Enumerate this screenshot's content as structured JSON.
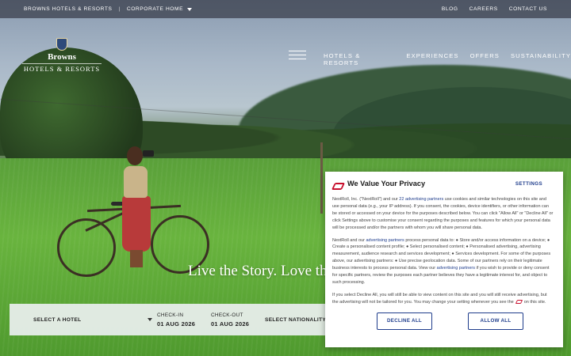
{
  "topbar": {
    "brand": "BROWNS HOTELS & RESORTS",
    "separator": "|",
    "corporate_home": "CORPORATE HOME",
    "links": [
      "BLOG",
      "CAREERS",
      "CONTACT US"
    ]
  },
  "logo": {
    "name": "Browns",
    "subtitle": "HOTELS & RESORTS"
  },
  "nav": {
    "items": [
      "HOTELS & RESORTS",
      "EXPERIENCES",
      "OFFERS",
      "SUSTAINABILITY"
    ]
  },
  "hero": {
    "tagline": "Live the Story. Love the"
  },
  "booking": {
    "hotel_label": "SELECT A HOTEL",
    "checkin_label": "CHECK-IN",
    "checkin_value": "01 AUG 2026",
    "checkout_label": "CHECK-OUT",
    "checkout_value": "01 AUG 2026",
    "nationality_label": "SELECT NATIONALITY"
  },
  "consent": {
    "title": "We Value Your Privacy",
    "settings_label": "SETTINGS",
    "p1_a": "NextRoll, Inc. (\"NextRoll\") and our ",
    "p1_link": "22 advertising partners",
    "p1_b": " use cookies and similar technologies on this site and use personal data (e.g., your IP address). If you consent, the cookies, device identifiers, or other information can be stored or accessed on your device for the purposes described below. You can click \"Allow All\" or \"Decline All\" or click Settings above to customise your consent regarding the purposes and features for which your personal data will be processed and/or the partners with whom you will share personal data.",
    "p2_a": "NextRoll and our ",
    "p2_link": "advertising partners",
    "p2_b": " process personal data to: ● Store and/or access information on a device; ● Create a personalised content profile; ● Select personalised content; ● Personalised advertising, advertising measurement, audience research and services development; ● Services development. For some of the purposes above, our advertising partners: ● Use precise geolocation data. Some of our partners rely on their legitimate business interests to process personal data. View our ",
    "p2_link2": "advertising partners",
    "p2_c": " if you wish to provide or deny consent for specific partners, review the purposes each partner believes they have a legitimate interest for, and object to such processing.",
    "p3_a": "If you select Decline All, you will still be able to view content on this site and you will still receive advertising, but the advertising will not be tailored for you. You may change your setting whenever you see the",
    "p3_b": "on this site.",
    "decline_label": "DECLINE ALL",
    "allow_label": "ALLOW ALL",
    "accent_color": "#1f3d8c",
    "brand_icon_color": "#c8102e"
  }
}
